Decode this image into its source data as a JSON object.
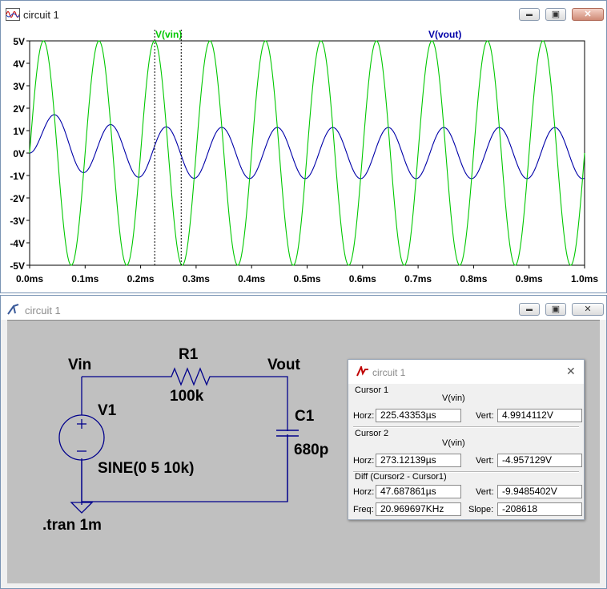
{
  "wave_window": {
    "title": "circuit 1",
    "controls": {
      "minimize": "▬",
      "maximize": "▣",
      "close": "✕"
    },
    "trace_labels": {
      "vin": "V(vin)",
      "vout": "V(vout)"
    },
    "colors": {
      "vin": "#00c800",
      "vout": "#0000a8",
      "cursor": "#000000"
    }
  },
  "chart_data": {
    "type": "line",
    "title": "",
    "xlabel": "",
    "ylabel": "",
    "x_range": [
      0,
      1.0
    ],
    "x_unit": "ms",
    "ylim": [
      -5,
      5
    ],
    "x_tick_labels": [
      "0.0ms",
      "0.1ms",
      "0.2ms",
      "0.3ms",
      "0.4ms",
      "0.5ms",
      "0.6ms",
      "0.7ms",
      "0.8ms",
      "0.9ms",
      "1.0ms"
    ],
    "y_tick_labels": [
      "5V",
      "4V",
      "3V",
      "2V",
      "1V",
      "0V",
      "-1V",
      "-2V",
      "-3V",
      "-4V",
      "-5V"
    ],
    "grid": "dotted lines at 5V and -5V",
    "legend": "top",
    "series": [
      {
        "name": "V(vin)",
        "kind": "sine",
        "amplitude": 5,
        "frequency_khz": 10,
        "offset": 0
      },
      {
        "name": "V(vout)",
        "kind": "rc_response",
        "R_ohm": 100000,
        "C_farad": 6.8e-10,
        "source_amplitude": 5,
        "frequency_khz": 10
      }
    ],
    "cursors_ms": [
      0.22543353,
      0.27312139
    ]
  },
  "schematic_window": {
    "title": "circuit 1",
    "controls": {
      "minimize": "▬",
      "maximize": "▣",
      "close": "✕"
    },
    "labels": {
      "vin_net": "Vin",
      "vout_net": "Vout",
      "r1_name": "R1",
      "r1_value": "100k",
      "c1_name": "C1",
      "c1_value": "680p",
      "v1_name": "V1",
      "v1_value": "SINE(0 5 10k)",
      "directive": ".tran 1m"
    },
    "wire_color": "#00008b"
  },
  "cursor_dialog": {
    "title": "circuit 1",
    "close": "✕",
    "cursor1": {
      "heading": "Cursor 1",
      "trace": "V(vin)",
      "horz_label": "Horz:",
      "horz": "225.43353µs",
      "vert_label": "Vert:",
      "vert": "4.9914112V"
    },
    "cursor2": {
      "heading": "Cursor 2",
      "trace": "V(vin)",
      "horz_label": "Horz:",
      "horz": "273.12139µs",
      "vert_label": "Vert:",
      "vert": "-4.957129V"
    },
    "diff": {
      "heading": "Diff (Cursor2 - Cursor1)",
      "horz_label": "Horz:",
      "horz": "47.687861µs",
      "vert_label": "Vert:",
      "vert": "-9.9485402V",
      "freq_label": "Freq:",
      "freq": "20.969697KHz",
      "slope_label": "Slope:",
      "slope": "-208618"
    }
  }
}
